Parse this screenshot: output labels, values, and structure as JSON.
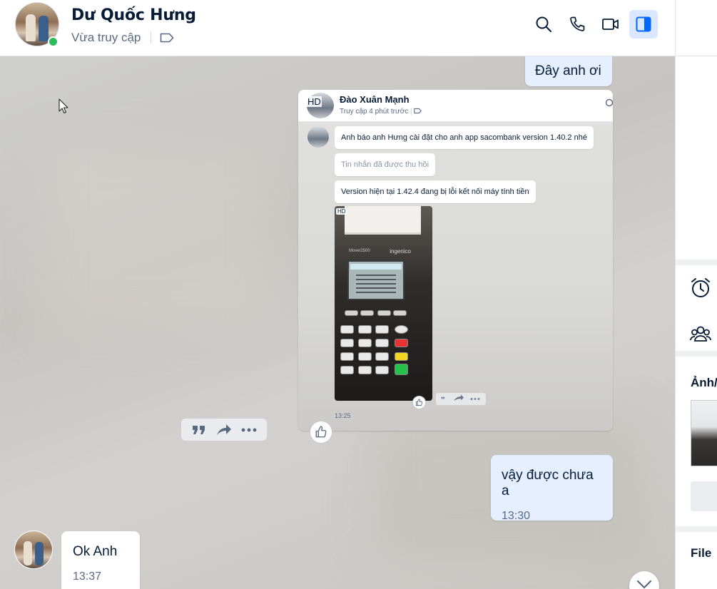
{
  "header": {
    "contact_name": "Dư Quốc Hưng",
    "status": "Vừa truy cập",
    "buttons": [
      "search-icon",
      "phone-icon",
      "video-icon",
      "sidebar-toggle-icon"
    ],
    "active_color": "#0068ff"
  },
  "messages": {
    "msg1": {
      "text": "Đây anh ơi"
    },
    "screenshot": {
      "hd": "HD",
      "name": "Đào Xuân Mạnh",
      "status": "Truy cập 4 phút trước",
      "bubble1": "Anh báo anh Hưng cài đặt cho anh app sacombank version 1.40.2 nhé",
      "bubble2": "Tin nhắn đã được thu hồi",
      "bubble3": "Version hiện tại 1.42.4 đang bị lỗi kết nối máy tính tiền",
      "photo_hd": "HD",
      "pos_brand_left": "Move/2500",
      "pos_brand_right": "ingenico",
      "time": "13:25"
    },
    "msg3": {
      "text": "vậy được chưa a",
      "time": "13:30"
    },
    "msg4": {
      "text": "Ok Anh",
      "time": "13:37"
    }
  },
  "sidebar": {
    "media_label": "Ảnh/",
    "file_label": "File"
  }
}
